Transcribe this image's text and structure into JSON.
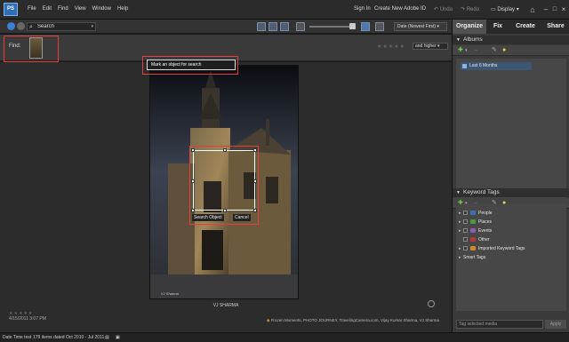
{
  "menu": {
    "logo": "PS",
    "items": [
      "File",
      "Edit",
      "Find",
      "View",
      "Window",
      "Help"
    ],
    "sign_in": "Sign In",
    "create_id": "Create New Adobe ID",
    "undo": "Undo",
    "redo": "Redo",
    "display": "Display"
  },
  "toolbar": {
    "search_value": "Search",
    "sort": "Date (Newest First)"
  },
  "findbar": {
    "label": "Find:",
    "rating_filter": "and higher"
  },
  "tooltip": "Mark an object for search",
  "photo": {
    "caption": "VJ SHARMA",
    "date": "4/15/2011 3:07 PM",
    "tags": "Frozen Moments, PHOTO JOURNEY, TravelingCamera.com, Vijay Kumar Sharma, VJ Sharma",
    "watermark": "VJ Sharma"
  },
  "selection": {
    "search_btn": "Search Object",
    "cancel_btn": "Cancel"
  },
  "panel": {
    "tabs": [
      "Organize",
      "Fix",
      "Create",
      "Share"
    ],
    "albums_header": "Albums",
    "album_items": [
      "Last 6 Months"
    ],
    "keyword_header": "Keyword Tags",
    "keywords": [
      {
        "label": "People",
        "color": "#3e6fb0",
        "arrow": "▸"
      },
      {
        "label": "Places",
        "color": "#4a9a3a",
        "arrow": "▸"
      },
      {
        "label": "Events",
        "color": "#8a5bb8",
        "arrow": "▸"
      },
      {
        "label": "Other",
        "color": "#b03a3a",
        "arrow": ""
      },
      {
        "label": "Imported Keyword Tags",
        "color": "#d08a2a",
        "arrow": "▸"
      },
      {
        "label": "Smart Tags",
        "color": "",
        "arrow": "▸"
      }
    ],
    "tag_placeholder": "Tag selected media",
    "apply": "Apply"
  },
  "status": {
    "sort": "Date Time test",
    "count": "179 items dated Oct 2010 - Jul 2011"
  },
  "colors": {
    "highlight": "#e2403f",
    "accent": "#2f6fb5"
  }
}
